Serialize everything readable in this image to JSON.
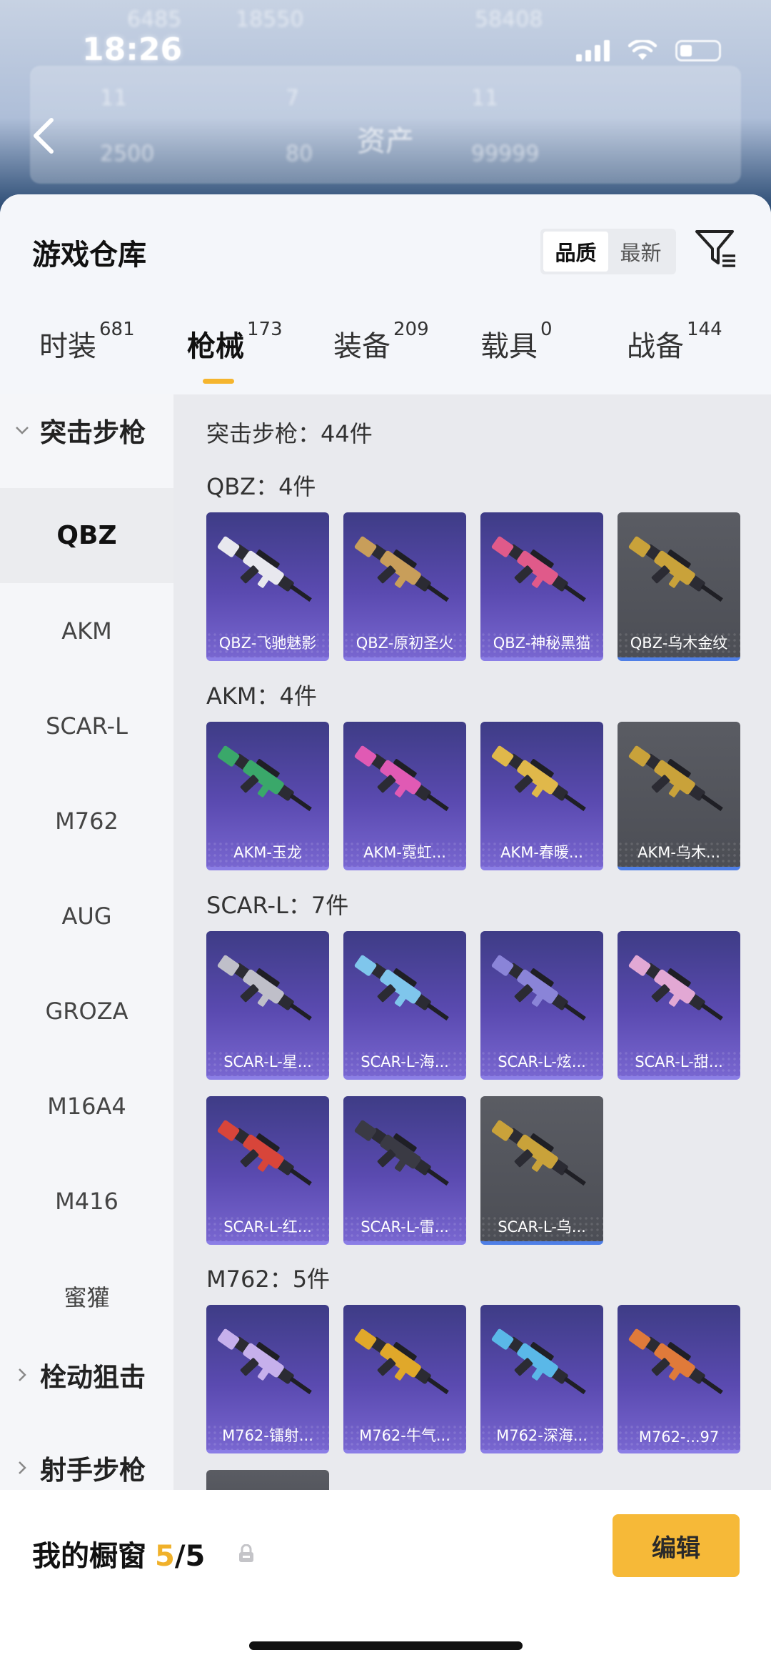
{
  "status_bar": {
    "time": "18:26"
  },
  "header": {
    "title": "资产",
    "blurred_stats": [
      "6485",
      "18550",
      "58408",
      "11",
      "7",
      "11",
      "2500",
      "80",
      "99999"
    ]
  },
  "warehouse": {
    "title": "游戏仓库",
    "sort": {
      "options": [
        "品质",
        "最新"
      ],
      "selected": "品质"
    }
  },
  "tabs": [
    {
      "label": "时装",
      "count": "681"
    },
    {
      "label": "枪械",
      "count": "173",
      "active": true
    },
    {
      "label": "装备",
      "count": "209"
    },
    {
      "label": "载具",
      "count": "0"
    },
    {
      "label": "战备",
      "count": "144"
    }
  ],
  "sidebar": {
    "groups": [
      {
        "label": "突击步枪",
        "expanded": true
      },
      {
        "label": "栓动狙击",
        "expanded": false
      },
      {
        "label": "射手步枪",
        "expanded": false
      }
    ],
    "items": [
      "QBZ",
      "AKM",
      "SCAR-L",
      "M762",
      "AUG",
      "GROZA",
      "M16A4",
      "M416",
      "蜜獾"
    ],
    "active_item": "QBZ"
  },
  "content": {
    "category_header": "突击步枪：44件",
    "sections": [
      {
        "header": "QBZ：4件",
        "cards": [
          {
            "name": "QBZ-飞驰魅影",
            "bg": "purple",
            "accent": "#e8e8ee"
          },
          {
            "name": "QBZ-原初圣火",
            "bg": "purple",
            "accent": "#c89e5a"
          },
          {
            "name": "QBZ-神秘黑猫",
            "bg": "purple",
            "accent": "#e05a8a"
          },
          {
            "name": "QBZ-乌木金纹",
            "bg": "gray",
            "accent": "#c9a23a"
          }
        ]
      },
      {
        "header": "AKM：4件",
        "cards": [
          {
            "name": "AKM-玉龙",
            "bg": "purple",
            "accent": "#3aa86a"
          },
          {
            "name": "AKM-霓虹...",
            "bg": "purple",
            "accent": "#e05ab4"
          },
          {
            "name": "AKM-春暖...",
            "bg": "purple",
            "accent": "#e0b84a"
          },
          {
            "name": "AKM-乌木...",
            "bg": "gray",
            "accent": "#c9a23a"
          }
        ]
      },
      {
        "header": "SCAR-L：7件",
        "cards": [
          {
            "name": "SCAR-L-星...",
            "bg": "purple",
            "accent": "#bfbfc9"
          },
          {
            "name": "SCAR-L-海...",
            "bg": "purple",
            "accent": "#7fc6ec"
          },
          {
            "name": "SCAR-L-炫...",
            "bg": "purple",
            "accent": "#8a84d8"
          },
          {
            "name": "SCAR-L-甜...",
            "bg": "purple",
            "accent": "#e2a8d4"
          },
          {
            "name": "SCAR-L-红...",
            "bg": "purple",
            "accent": "#d8453a"
          },
          {
            "name": "SCAR-L-雷...",
            "bg": "purple",
            "accent": "#3a3a44"
          },
          {
            "name": "SCAR-L-乌...",
            "bg": "gray",
            "accent": "#c9a23a"
          }
        ]
      },
      {
        "header": "M762：5件",
        "cards": [
          {
            "name": "M762-镭射...",
            "bg": "purple",
            "accent": "#c6b0ec"
          },
          {
            "name": "M762-牛气...",
            "bg": "purple",
            "accent": "#e0a82a"
          },
          {
            "name": "M762-深海...",
            "bg": "purple",
            "accent": "#5ab8e8"
          },
          {
            "name": "M762-...97",
            "bg": "purple",
            "accent": "#e07a3a"
          }
        ]
      }
    ]
  },
  "showcase": {
    "label": "我的橱窗",
    "current": "5",
    "separator": "/",
    "total": "5",
    "edit_label": "编辑"
  }
}
